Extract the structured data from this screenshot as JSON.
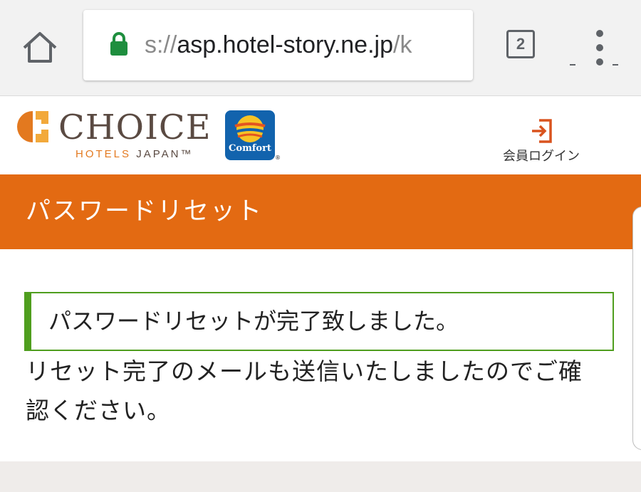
{
  "browser": {
    "url_scheme": "s://",
    "url_host": "asp.hotel-story.ne.jp",
    "url_path": "/k",
    "tab_count": "2",
    "icons": {
      "home": "home-icon",
      "lock": "lock-icon",
      "tabs": "tab-switcher-icon",
      "menu": "overflow-menu-icon"
    },
    "colors": {
      "lock": "#1e8e3e",
      "chrome_bg": "#f2f2f2"
    }
  },
  "header": {
    "brand_name": "CHOICE",
    "brand_sub_hotels": "HOTELS",
    "brand_sub_japan": "JAPAN™",
    "comfort_logo_text": "Comfort",
    "comfort_reg": "®",
    "login_label": "会員ログイン",
    "colors": {
      "brand_orange": "#e3791f",
      "brand_brown": "#5a4a42",
      "comfort_blue": "#1263ad"
    }
  },
  "page": {
    "title": "パスワードリセット",
    "notice": "パスワードリセットが完了致しました。",
    "message": "リセット完了のメールも送信いたしましたのでご確認ください。",
    "colors": {
      "title_bar": "#e36a12",
      "notice_border": "#4f9e1e"
    }
  }
}
